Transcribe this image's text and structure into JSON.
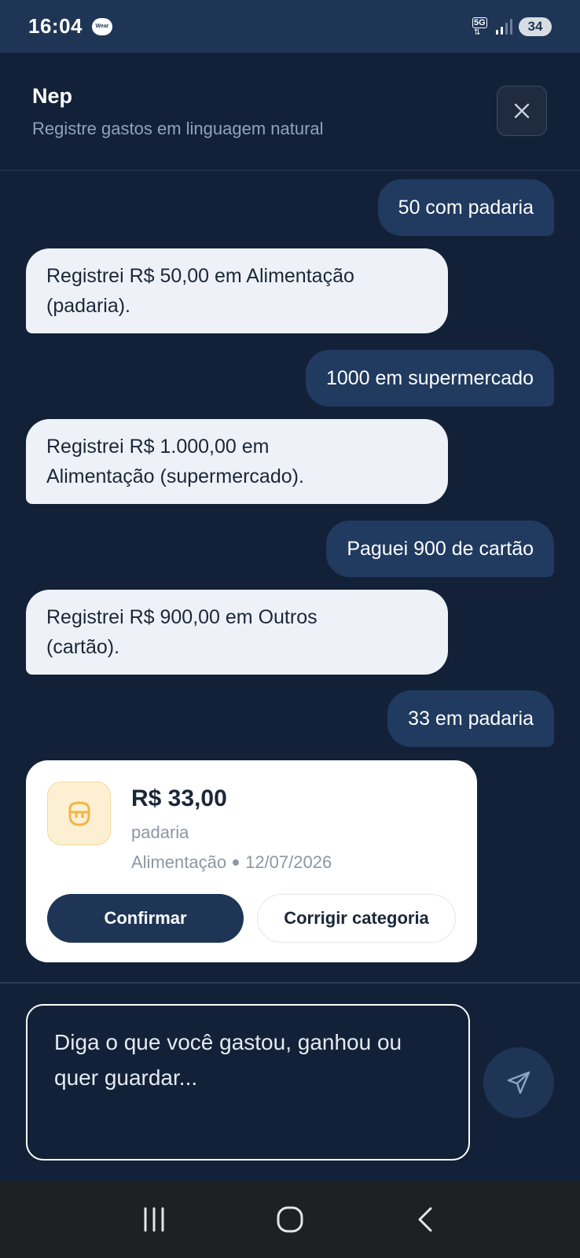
{
  "status_bar": {
    "time": "16:04",
    "wear_label": "Wear",
    "network": "5G",
    "battery": "34"
  },
  "header": {
    "title": "Nep",
    "subtitle": "Registre gastos em linguagem natural"
  },
  "messages": [
    {
      "role": "user",
      "text": "50 com padaria"
    },
    {
      "role": "assistant",
      "lines": [
        "Registrei R$ 50,00 em Alimentação",
        "(padaria)."
      ]
    },
    {
      "role": "user",
      "text": "1000 em supermercado"
    },
    {
      "role": "assistant",
      "lines": [
        "Registrei R$ 1.000,00 em",
        "Alimentação (supermercado)."
      ]
    },
    {
      "role": "user",
      "text": "Paguei 900 de cartão"
    },
    {
      "role": "assistant",
      "lines": [
        "Registrei R$ 900,00 em Outros",
        "(cartão)."
      ]
    },
    {
      "role": "user",
      "text": "33 em padaria"
    }
  ],
  "expense_card": {
    "amount": "R$ 33,00",
    "description": "padaria",
    "category": "Alimentação",
    "date": "12/07/2026",
    "icon": "food-icon",
    "confirm_label": "Confirmar",
    "fix_label": "Corrigir categoria"
  },
  "composer": {
    "placeholder": "Diga o que você gastou, ganhou ou quer guardar...",
    "send_icon": "send-icon"
  },
  "colors": {
    "background": "#132138",
    "status_bar": "#1e3556",
    "user_bubble": "#203a60",
    "assistant_bubble": "#eef2f8",
    "primary_button": "#1e3556",
    "category_icon_bg": "#fdf0d2"
  }
}
